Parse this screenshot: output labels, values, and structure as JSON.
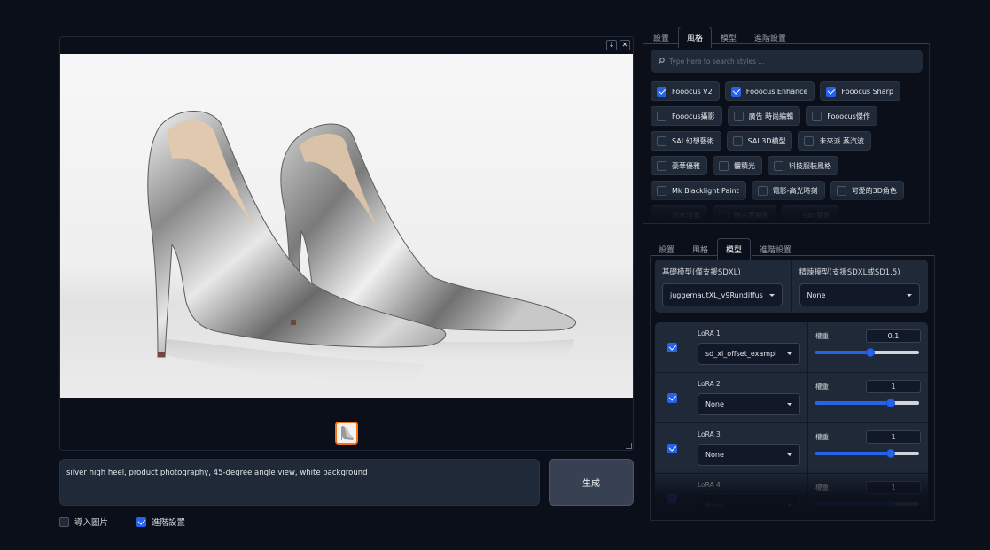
{
  "gallery": {
    "download_icon": "download-icon",
    "close_icon": "close-icon"
  },
  "prompt": {
    "value": "silver high heel, product photography, 45-degree angle view, white background"
  },
  "generate_label": "生成",
  "options": {
    "input_image_label": "導入圖片",
    "input_image_checked": false,
    "advanced_label": "進階設置",
    "advanced_checked": true
  },
  "top_tabs": [
    "設置",
    "風格",
    "模型",
    "進階設置"
  ],
  "top_tabs_active": 1,
  "styles": {
    "search_placeholder": "Type here to search styles ...",
    "rows": [
      [
        {
          "label": "Fooocus V2",
          "checked": true
        },
        {
          "label": "Fooocus Enhance",
          "checked": true
        },
        {
          "label": "Fooocus Sharp",
          "checked": true
        }
      ],
      [
        {
          "label": "Fooocus攝影",
          "checked": false
        },
        {
          "label": "廣告 時尚編輯",
          "checked": false
        },
        {
          "label": "Fooocus傑作",
          "checked": false
        }
      ],
      [
        {
          "label": "SAI 幻想藝術",
          "checked": false
        },
        {
          "label": "SAI 3D模型",
          "checked": false
        },
        {
          "label": "未來派 蒸汽波",
          "checked": false
        }
      ],
      [
        {
          "label": "豪華優雅",
          "checked": false
        },
        {
          "label": "體積光",
          "checked": false
        },
        {
          "label": "科技服裝風格",
          "checked": false
        }
      ],
      [
        {
          "label": "Mk Blacklight Paint",
          "checked": false
        },
        {
          "label": "電影-高光時刻",
          "checked": false
        },
        {
          "label": "可愛的3D角色",
          "checked": false
        }
      ],
      [
        {
          "label": "日本漫畫",
          "checked": false
        },
        {
          "label": "隋古董攝影",
          "checked": false
        },
        {
          "label": "SAI 攝影",
          "checked": false
        }
      ]
    ]
  },
  "bottom_tabs": [
    "設置",
    "風格",
    "模型",
    "進階設置"
  ],
  "bottom_tabs_active": 2,
  "models": {
    "base_label": "基礎模型(僅支援SDXL)",
    "base_value": "juggernautXL_v9Rundiffus",
    "refiner_label": "精煉模型(支援SDXL或SD1.5)",
    "refiner_value": "None"
  },
  "weight_label": "權重",
  "loras": [
    {
      "label": "LoRA 1",
      "value": "sd_xl_offset_exampl",
      "weight": "0.1",
      "enabled": true,
      "level": 0.53
    },
    {
      "label": "LoRA 2",
      "value": "None",
      "weight": "1",
      "enabled": true,
      "level": 0.73
    },
    {
      "label": "LoRA 3",
      "value": "None",
      "weight": "1",
      "enabled": true,
      "level": 0.73
    },
    {
      "label": "LoRA 4",
      "value": "None",
      "weight": "1",
      "enabled": true,
      "level": 0.73
    }
  ]
}
